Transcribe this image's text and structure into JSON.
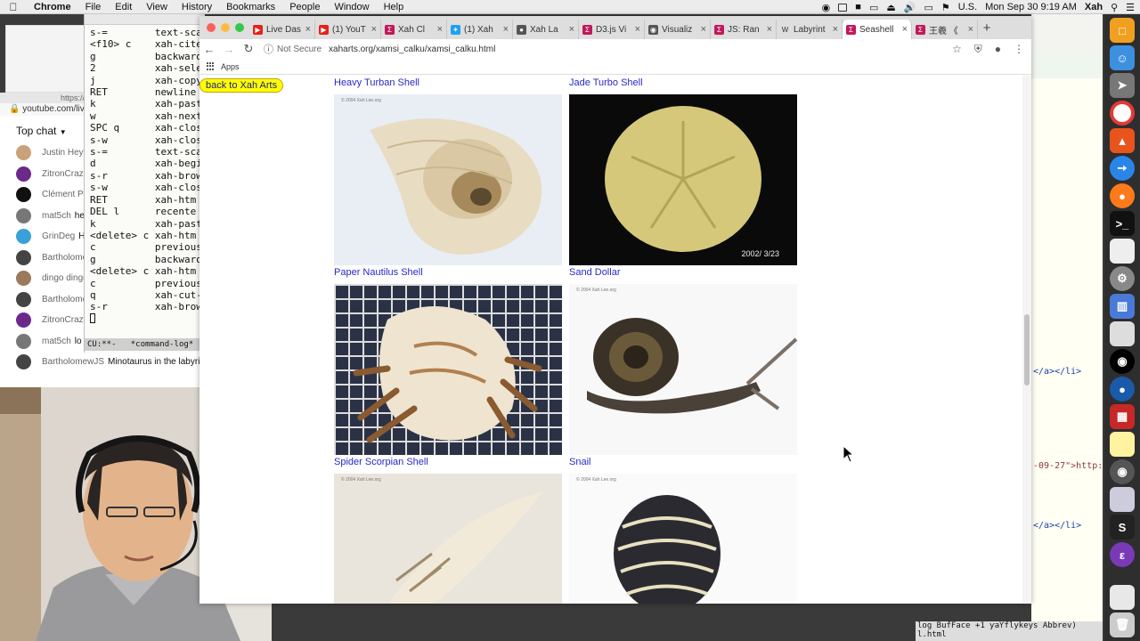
{
  "menubar": {
    "app": "Chrome",
    "items": [
      "File",
      "Edit",
      "View",
      "History",
      "Bookmarks",
      "People",
      "Window",
      "Help"
    ],
    "keyboard": "U.S.",
    "clock": "Mon Sep 30  9:19 AM",
    "user": "Xah"
  },
  "youtube": {
    "url": "youtube.com/liv",
    "url_top": "https://",
    "top_chat": "Top chat",
    "messages": [
      {
        "name": "Justin Heye",
        "text": "",
        "color": "#c9a27a"
      },
      {
        "name": "ZitronCrazy",
        "text": "",
        "color": "#6b2a8a"
      },
      {
        "name": "Clément Po",
        "text": "",
        "color": "#111111"
      },
      {
        "name": "mat5ch",
        "text": "he",
        "color": "#777777"
      },
      {
        "name": "GrinDeg",
        "text": "H",
        "color": "#3aa0d8"
      },
      {
        "name": "Bartholome",
        "text": "",
        "color": "#444444"
      },
      {
        "name": "dingo dinge",
        "text": "",
        "color": "#9a7a5a"
      },
      {
        "name": "Bartholome",
        "text": "",
        "color": "#444444"
      },
      {
        "name": "ZitronCrazy",
        "text": "",
        "color": "#6b2a8a"
      },
      {
        "name": "mat5ch",
        "text": "lo",
        "color": "#777777"
      },
      {
        "name": "BartholomewJS",
        "text": "Minotaurus in the labyrir",
        "color": "#444444"
      }
    ]
  },
  "terminal": {
    "rows": [
      "s-=        text-sca",
      "<f10> c    xah-cite",
      "g          backward",
      "2          xah-sele",
      "j          xah-copy",
      "RET        newline",
      "k          xah-past",
      "w          xah-next",
      "SPC q      xah-clos",
      "s-w        xah-clos",
      "s-=        text-sca",
      "d          xah-begi",
      "s-r        xah-brow",
      "s-w        xah-clos",
      "RET        xah-htm",
      "DEL l      recente",
      "k          xah-past",
      "<delete> c xah-htm",
      "c          previous",
      "g          backward",
      "<delete> c xah-htm",
      "c          previous",
      "q          xah-cut-",
      "s-r        xah-brow"
    ],
    "modeline": "CU:**-   *command-log*"
  },
  "emacs_right": {
    "lines": [
      "</a></li>",
      "-09-27\">http:",
      "</a></li>"
    ],
    "modeline": "log BufFace +1 ƴaƳflykeys Abbrev)",
    "modeline2": "l.html"
  },
  "chrome": {
    "tabs": [
      {
        "title": "Live Das",
        "fav": "#e62117",
        "icon": "yt"
      },
      {
        "title": "(1) YouT",
        "fav": "#e62117",
        "icon": "yt"
      },
      {
        "title": "Xah Cl",
        "fav": "#c2185b",
        "icon": "sigma"
      },
      {
        "title": "(1) Xah",
        "fav": "#1da1f2",
        "icon": "tw"
      },
      {
        "title": "Xah La",
        "fav": "#555555",
        "icon": "gh"
      },
      {
        "title": "D3.js Vi",
        "fav": "#c2185b",
        "icon": "sigma"
      },
      {
        "title": "Visualiz",
        "fav": "#555555",
        "icon": "globe"
      },
      {
        "title": "JS: Ran",
        "fav": "#c2185b",
        "icon": "sigma"
      },
      {
        "title": "Labyrint",
        "fav": "#333333",
        "icon": "w"
      },
      {
        "title": "Seashell",
        "fav": "#c2185b",
        "icon": "sigma",
        "active": true
      },
      {
        "title": "王羲 《",
        "fav": "#c2185b",
        "icon": "sigma"
      }
    ],
    "not_secure": "Not Secure",
    "url": "xaharts.org/xamsi_calku/xamsi_calku.html",
    "bookmarks_apps": "Apps"
  },
  "page": {
    "back_button": "back to Xah Arts",
    "captions": [
      "Heavy Turban Shell",
      "Jade Turbo Shell",
      "Paper Nautilus Shell",
      "Sand Dollar",
      "Spider Scorpian Shell",
      "Snail"
    ],
    "copyright": "© 2004 Xah Lee.org",
    "sand_dollar_date": "2002/ 3/23"
  }
}
